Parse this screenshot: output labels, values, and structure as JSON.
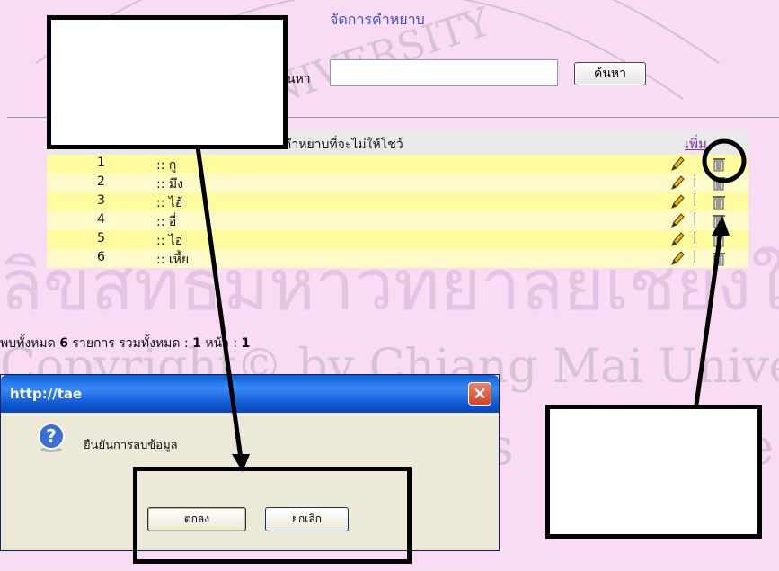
{
  "page": {
    "title": "จัดการคำหยาบ",
    "search_label": "นหา",
    "search_value": "",
    "search_button": "ค้นหา"
  },
  "table": {
    "column_header": "คำหยาบที่จะไม่ให้โชว์",
    "add_link": "เพิ่ม",
    "separator": "|",
    "rows": [
      {
        "index": "1",
        "word": ":: กู"
      },
      {
        "index": "2",
        "word": ":: มึง"
      },
      {
        "index": "3",
        "word": ":: ไอ้"
      },
      {
        "index": "4",
        "word": ":: อี่"
      },
      {
        "index": "5",
        "word": ":: ไอ่"
      },
      {
        "index": "6",
        "word": ":: เหี้ย"
      }
    ]
  },
  "summary": {
    "prefix": "พบทั้งหมด ",
    "count": "6",
    "middle": " รายการ รวมทั้งหมด : ",
    "pages": "1",
    "page_label": " หน้า : ",
    "current_page": "1"
  },
  "dialog": {
    "title": "http://tae",
    "message": "ยืนยันการลบข้อมูล",
    "ok_label": "ตกลง",
    "cancel_label": "ยกเลิก",
    "close_glyph": "✕"
  },
  "watermark": {
    "lines": [
      "ลิขสิทธิ์มหาวิทยาลัยเชียงใหม่",
      "Copyright© by Chiang Mai University",
      "All rights reserved",
      "MAI UNIVERSITY"
    ]
  },
  "colors": {
    "background": "#f9dcf4",
    "title_blue": "#3a4fd6",
    "row_yellow": "#fffb9e",
    "row_light": "#fffbc8",
    "header_gray": "#e9e9e9",
    "add_link": "#8a2ba3",
    "dialog_titlebar": "#0a5fd8"
  },
  "icons": {
    "edit": "pencil-icon",
    "delete": "trash-icon",
    "dialog": "question-icon",
    "close": "close-icon"
  }
}
